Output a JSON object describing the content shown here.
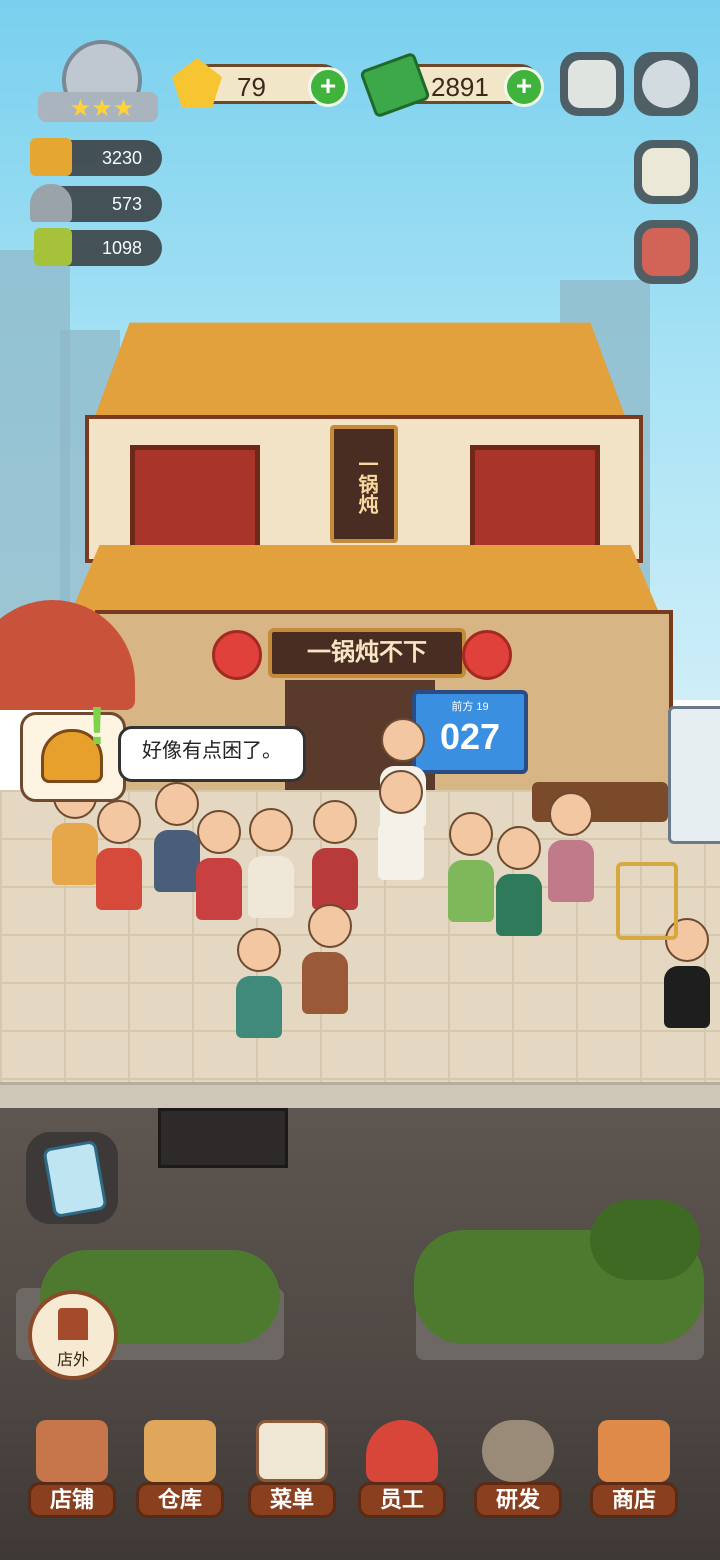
{
  "hud": {
    "gems": "79",
    "cash": "2891",
    "stat_gold": "3230",
    "stat_dish": "573",
    "stat_recipe": "1098",
    "stars": 3
  },
  "shop": {
    "vertical_sign": "一锅炖",
    "banner": "一锅炖不下"
  },
  "queue_board": {
    "header": "前方 19",
    "number": "027"
  },
  "bubble": {
    "text": "好像有点困了。"
  },
  "outside_button": {
    "label": "店外"
  },
  "nav": [
    {
      "label": "店铺",
      "icon": "shop-building-icon"
    },
    {
      "label": "仓库",
      "icon": "warehouse-boxes-icon"
    },
    {
      "label": "菜单",
      "icon": "menu-clipboard-icon"
    },
    {
      "label": "员工",
      "icon": "staff-chef-icon"
    },
    {
      "label": "研发",
      "icon": "research-wok-icon"
    },
    {
      "label": "商店",
      "icon": "store-stall-icon"
    }
  ],
  "colors": {
    "sky": "#79d0ee",
    "roof": "#e2a13c",
    "nav_tag": "#8a3f1f",
    "plus_green": "#3fb33b"
  }
}
